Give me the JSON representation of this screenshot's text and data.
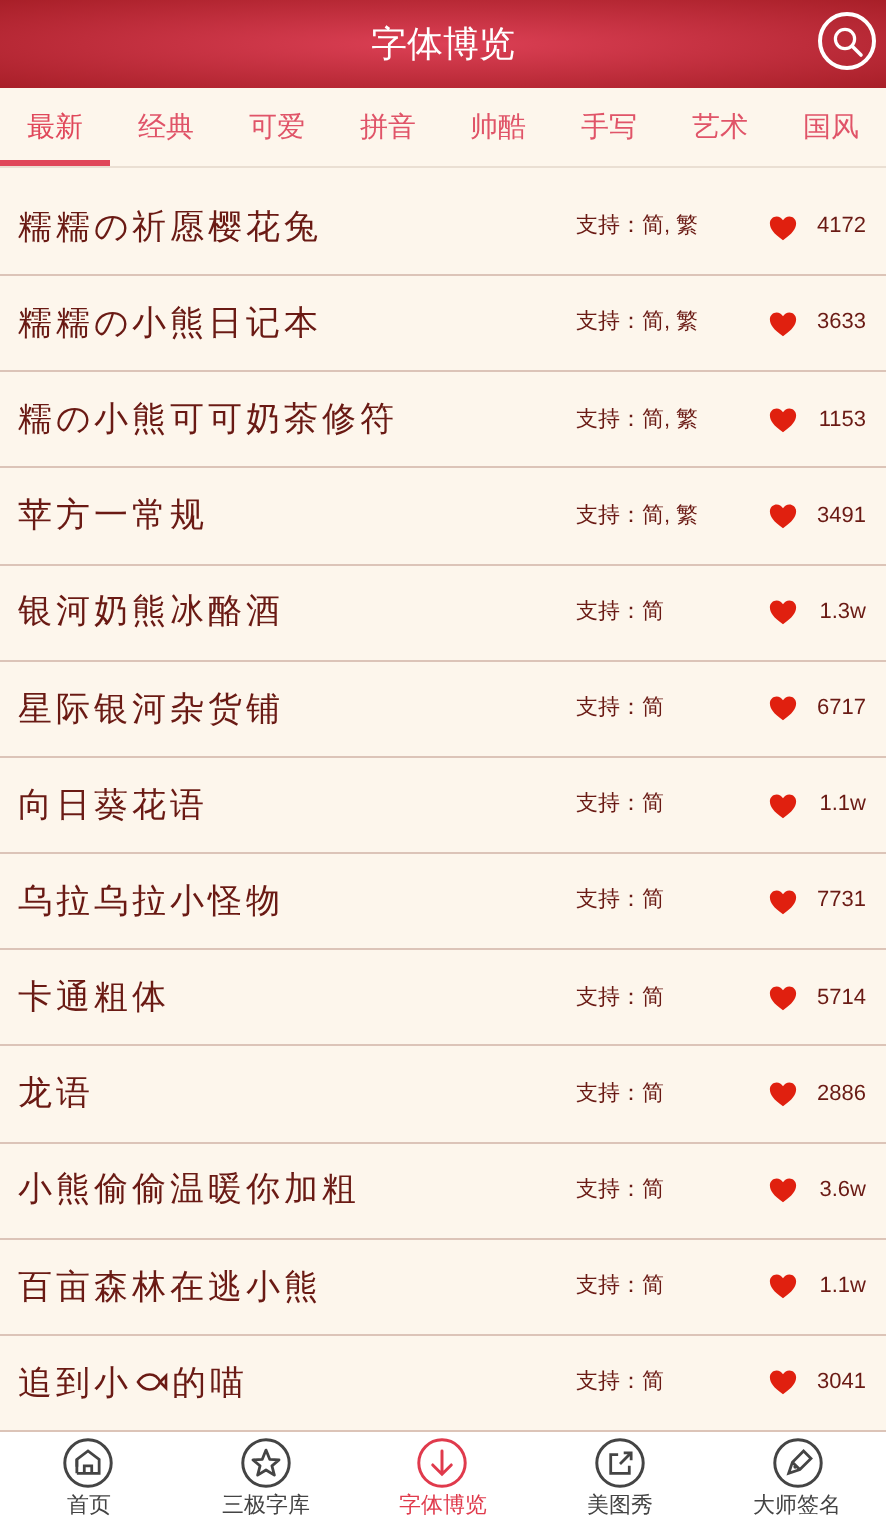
{
  "header": {
    "title": "字体博览"
  },
  "tabs": [
    {
      "label": "最新",
      "selected": true
    },
    {
      "label": "经典",
      "selected": false
    },
    {
      "label": "可爱",
      "selected": false
    },
    {
      "label": "拼音",
      "selected": false
    },
    {
      "label": "帅酷",
      "selected": false
    },
    {
      "label": "手写",
      "selected": false
    },
    {
      "label": "艺术",
      "selected": false
    },
    {
      "label": "国风",
      "selected": false
    }
  ],
  "fonts": [
    {
      "name": "糯糯の祈愿樱花兔",
      "support": "支持：简, 繁",
      "likes": "4172"
    },
    {
      "name": "糯糯の小熊日记本",
      "support": "支持：简, 繁",
      "likes": "3633"
    },
    {
      "name": "糯の小熊可可奶茶修符",
      "support": "支持：简, 繁",
      "likes": "1153"
    },
    {
      "name": "苹方一常规",
      "support": "支持：简, 繁",
      "likes": "3491"
    },
    {
      "name": "银河奶熊冰酪酒",
      "support": "支持：简",
      "likes": "1.3w"
    },
    {
      "name": "星际银河杂货铺",
      "support": "支持：简",
      "likes": "6717"
    },
    {
      "name": "向日葵花语",
      "support": "支持：简",
      "likes": "1.1w"
    },
    {
      "name": "乌拉乌拉小怪物",
      "support": "支持：简",
      "likes": "7731"
    },
    {
      "name": "卡通粗体",
      "support": "支持：简",
      "likes": "5714"
    },
    {
      "name": "龙语",
      "support": "支持：简",
      "likes": "2886"
    },
    {
      "name": "小熊偷偷温暖你加粗",
      "support": "支持：简",
      "likes": "3.6w"
    },
    {
      "name": "百亩森林在逃小熊",
      "support": "支持：简",
      "likes": "1.1w"
    },
    {
      "name": "追到小",
      "name_after": "的喵",
      "support": "支持：简",
      "likes": "3041"
    }
  ],
  "nav": [
    {
      "label": "首页",
      "kind": "house",
      "selected": false
    },
    {
      "label": "三极字库",
      "kind": "star",
      "selected": false
    },
    {
      "label": "字体博览",
      "kind": "download",
      "selected": true
    },
    {
      "label": "美图秀",
      "kind": "share",
      "selected": false
    },
    {
      "label": "大师签名",
      "kind": "pen",
      "selected": false
    }
  ]
}
